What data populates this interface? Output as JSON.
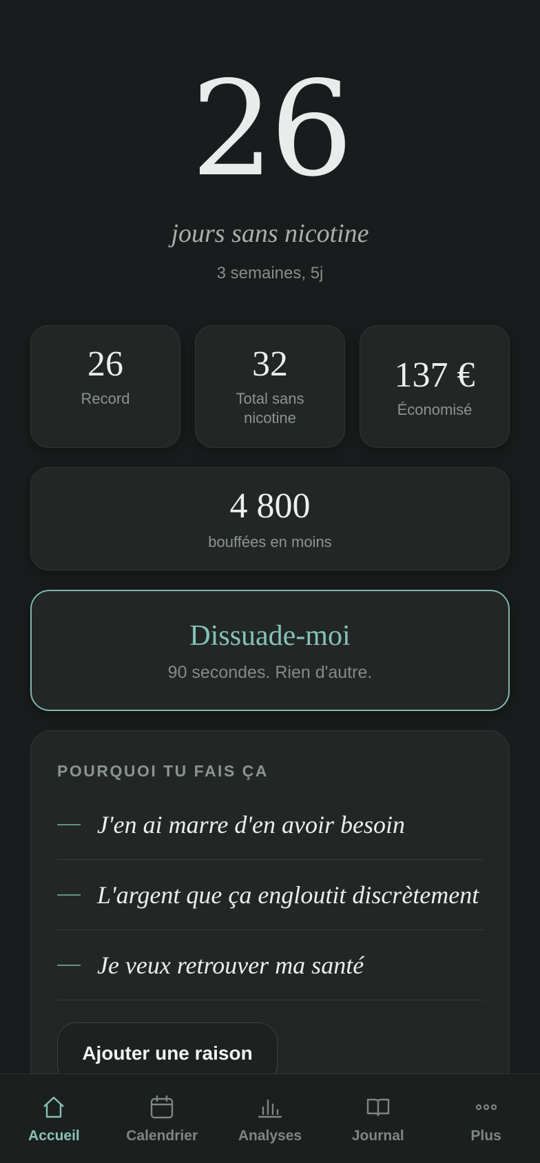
{
  "streak": {
    "days": "26",
    "label": "jours sans nicotine",
    "duration": "3 semaines, 5j"
  },
  "stats": [
    {
      "value": "26",
      "label": "Record"
    },
    {
      "value": "32",
      "label": "Total sans nicotine"
    },
    {
      "value": "137 €",
      "label": "Économisé"
    }
  ],
  "puffs": {
    "value": "4 800",
    "label": "bouffées en moins"
  },
  "dissuade": {
    "title": "Dissuade-moi",
    "subtitle": "90 secondes. Rien d'autre."
  },
  "reasons": {
    "heading": "POURQUOI TU FAIS ÇA",
    "items": [
      "J'en ai marre d'en avoir besoin",
      "L'argent que ça engloutit discrètement",
      "Je veux retrouver ma santé"
    ],
    "add_label": "Ajouter une raison"
  },
  "tabs": [
    {
      "label": "Accueil",
      "icon": "home-icon",
      "active": true
    },
    {
      "label": "Calendrier",
      "icon": "calendar-icon",
      "active": false
    },
    {
      "label": "Analyses",
      "icon": "bar-chart-icon",
      "active": false
    },
    {
      "label": "Journal",
      "icon": "book-icon",
      "active": false
    },
    {
      "label": "Plus",
      "icon": "more-icon",
      "active": false
    }
  ],
  "colors": {
    "accent": "#86c2b6",
    "background": "#191c1c",
    "card": "#222726"
  }
}
